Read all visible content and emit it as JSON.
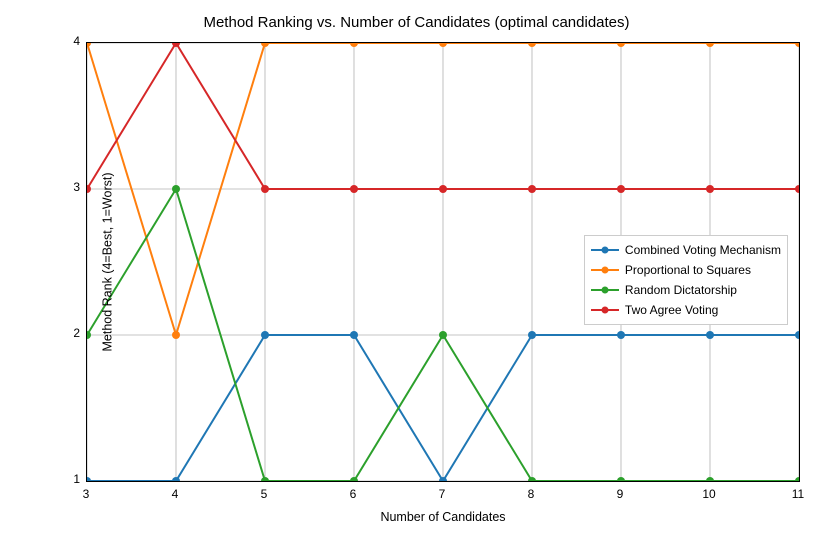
{
  "chart_data": {
    "type": "line",
    "title": "Method Ranking vs. Number of Candidates (optimal candidates)",
    "xlabel": "Number of Candidates",
    "ylabel": "Method Rank (4=Best, 1=Worst)",
    "x": [
      3,
      4,
      5,
      6,
      7,
      8,
      9,
      10,
      11
    ],
    "xlim": [
      3,
      11
    ],
    "ylim": [
      1,
      4
    ],
    "yticks": [
      1,
      2,
      3,
      4
    ],
    "legend_position": "center-right",
    "grid": true,
    "series": [
      {
        "name": "Combined Voting Mechanism",
        "color": "#1f77b4",
        "values": [
          1,
          1,
          2,
          2,
          1,
          2,
          2,
          2,
          2
        ]
      },
      {
        "name": "Proportional to Squares",
        "color": "#ff7f0e",
        "values": [
          4,
          2,
          4,
          4,
          4,
          4,
          4,
          4,
          4
        ]
      },
      {
        "name": "Random Dictatorship",
        "color": "#2ca02c",
        "values": [
          2,
          3,
          1,
          1,
          2,
          1,
          1,
          1,
          1
        ]
      },
      {
        "name": "Two Agree Voting",
        "color": "#d62728",
        "values": [
          3,
          4,
          3,
          3,
          3,
          3,
          3,
          3,
          3
        ]
      }
    ]
  }
}
